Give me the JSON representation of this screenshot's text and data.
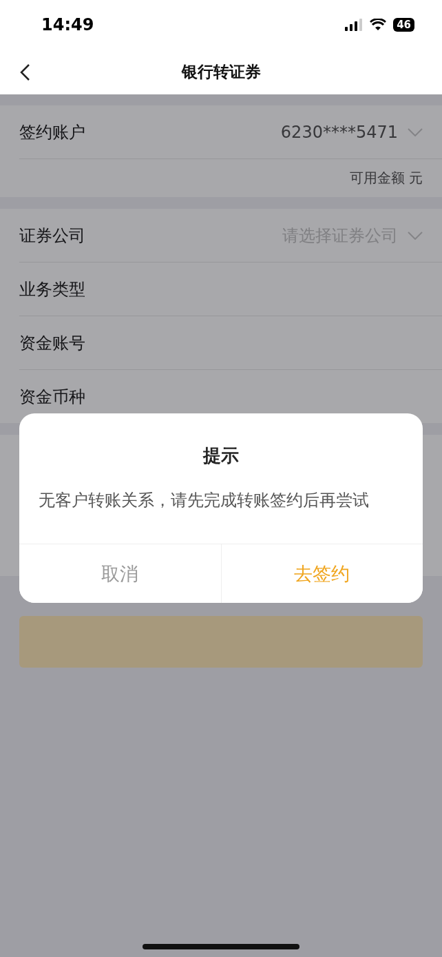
{
  "status_bar": {
    "time": "14:49",
    "battery": "46"
  },
  "nav": {
    "title": "银行转证券"
  },
  "sections": [
    {
      "rows": [
        {
          "kind": "select",
          "label": "签约账户",
          "value": "6230****5471"
        },
        {
          "kind": "note",
          "value": "可用金额 元"
        }
      ]
    },
    {
      "rows": [
        {
          "kind": "select",
          "label": "证券公司",
          "placeholder": "请选择证券公司"
        },
        {
          "kind": "plain",
          "label": "业务类型"
        },
        {
          "kind": "plain",
          "label": "资金账号"
        },
        {
          "kind": "plain",
          "label": "资金币种"
        }
      ]
    }
  ],
  "dialog": {
    "title": "提示",
    "message": "无客户转账关系，请先完成转账签约后再尝试",
    "buttons": [
      {
        "kind": "cancel",
        "label": "取消"
      },
      {
        "kind": "confirm",
        "label": "去签约"
      }
    ]
  }
}
